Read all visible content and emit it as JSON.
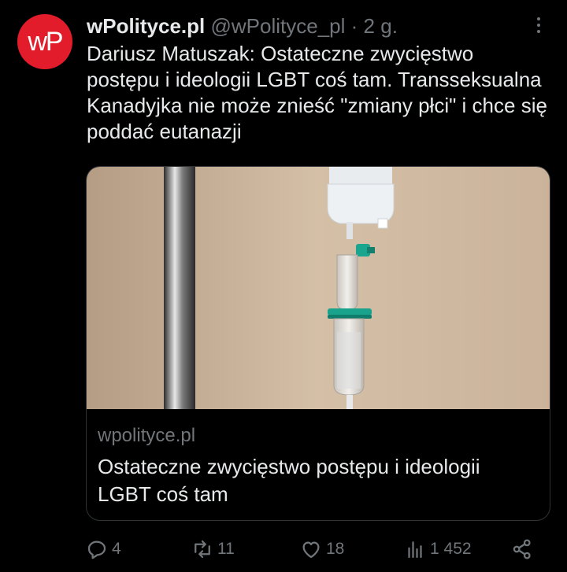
{
  "account": {
    "avatar_text": "wP",
    "avatar_color": "#e31c2b",
    "name": "wPolityce.pl",
    "handle": "@wPolityce_pl",
    "separator": "·",
    "time": "2 g."
  },
  "tweet": {
    "text": "Dariusz Matuszak: Ostateczne zwycięstwo postępu i ideologii LGBT coś tam. Transseksualna Kanadyjka nie może znieść \"zmiany płci\" i chce się poddać eutanazji"
  },
  "card": {
    "image_icon": "iv-drip-photo",
    "domain": "wpolityce.pl",
    "title": "Ostateczne zwycięstwo postępu i ideologii LGBT coś tam"
  },
  "actions": {
    "replies": "4",
    "retweets": "11",
    "likes": "18",
    "views": "1 452"
  },
  "colors": {
    "background": "#000000",
    "text": "#e7e9ea",
    "secondary": "#71767b",
    "border": "#2f3336"
  }
}
